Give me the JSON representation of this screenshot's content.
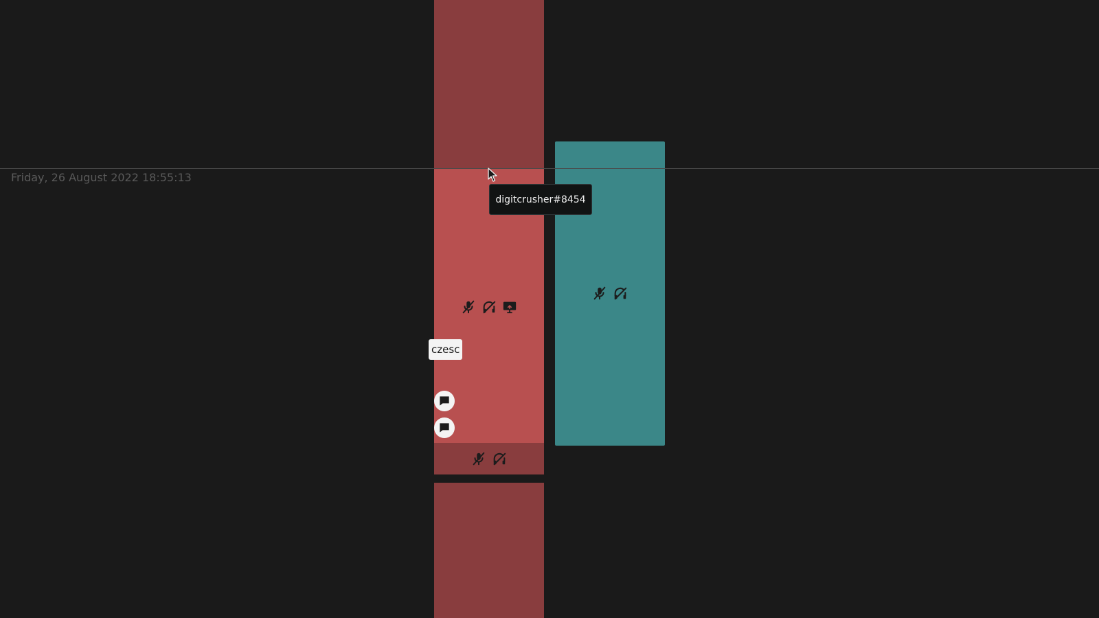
{
  "timestamp": "Friday, 26 August 2022 18:55:13",
  "tooltip": {
    "text": "digitcrusher#8454"
  },
  "chat_chip": {
    "text": "czesc"
  },
  "colors": {
    "background": "#1a1a1a",
    "tile_dark_red": "#893d3e",
    "tile_active_red": "#b85050",
    "tile_teal": "#3b8788",
    "footer_red": "#893d3e"
  },
  "icons": {
    "muted_mic": "mic-off-icon",
    "deafened": "headphones-off-icon",
    "screen_share": "screen-share-icon",
    "chat": "chat-bubble-icon",
    "cursor": "mouse-cursor-icon"
  }
}
